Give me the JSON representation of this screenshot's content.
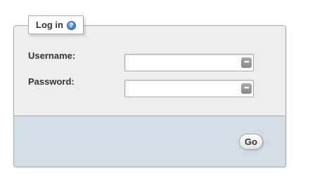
{
  "login_form": {
    "title": "Log in",
    "help_icon": "help-icon",
    "help_icon_glyph": "?",
    "username": {
      "label": "Username:",
      "value": "",
      "placeholder": "",
      "icon": "password-manager-icon",
      "icon_glyph": "•••"
    },
    "password": {
      "label": "Password:",
      "value": "",
      "placeholder": "",
      "icon": "password-manager-icon",
      "icon_glyph": "•••"
    },
    "submit_label": "Go"
  },
  "colors": {
    "panel_background": "#eeeeee",
    "footer_background": "#d4dde5",
    "border": "#aaaaaa",
    "text": "#333333",
    "help_icon": "#4a86cf"
  }
}
